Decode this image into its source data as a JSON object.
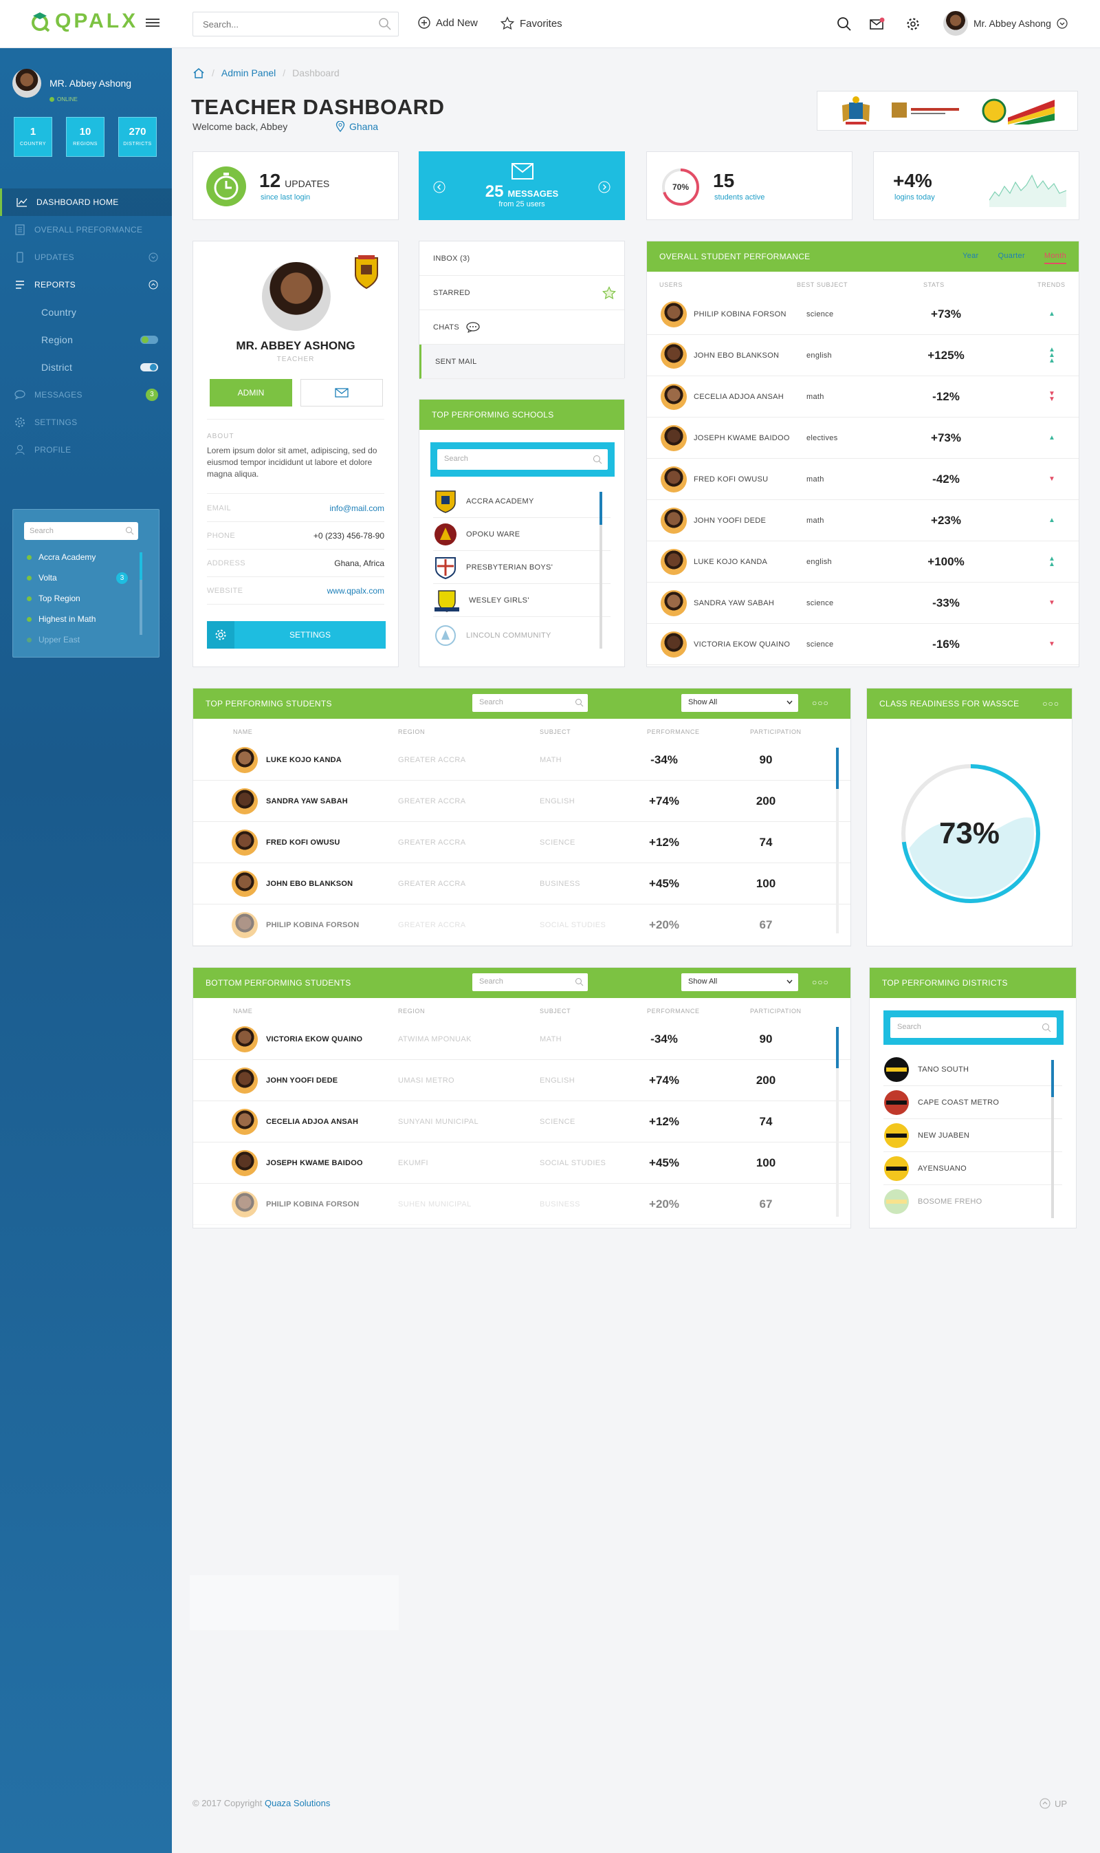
{
  "brand": {
    "logo": "QPALX",
    "accent": "#7cc242",
    "teal": "#1ebde0",
    "blue": "#1d7fb8",
    "sidebar_bg": "#1d6aa0"
  },
  "topbar": {
    "search_placeholder": "Search...",
    "add_new": "Add New",
    "favorites": "Favorites",
    "user": "Mr. Abbey Ashong"
  },
  "sidebar": {
    "user": "MR. Abbey Ashong",
    "status": "ONLINE",
    "stats": [
      {
        "value": "1",
        "label": "COUNTRY"
      },
      {
        "value": "10",
        "label": "REGIONS"
      },
      {
        "value": "270",
        "label": "DISTRICTS"
      }
    ],
    "nav": [
      {
        "label": "DASHBOARD HOME",
        "icon": "chart-icon"
      },
      {
        "label": "OVERALL PREFORMANCE",
        "icon": "document-icon"
      },
      {
        "label": "UPDATES",
        "icon": "phone-icon"
      },
      {
        "label": "REPORTS",
        "icon": "list-icon"
      },
      {
        "label": "Country"
      },
      {
        "label": "Region"
      },
      {
        "label": "District"
      },
      {
        "label": "MESSAGES",
        "icon": "chat-icon",
        "badge": "3"
      },
      {
        "label": "SETTINGS",
        "icon": "gear-icon"
      },
      {
        "label": "PROFILE",
        "icon": "user-icon"
      }
    ],
    "panel": {
      "search": "Search",
      "items": [
        {
          "label": "Accra Academy"
        },
        {
          "label": "Volta",
          "badge": "3"
        },
        {
          "label": "Top Region"
        },
        {
          "label": "Highest in Math"
        },
        {
          "label": "Upper East"
        }
      ]
    }
  },
  "breadcrumb": {
    "item1": "Admin Panel",
    "item2": "Dashboard"
  },
  "page": {
    "title": "TEACHER DASHBOARD",
    "welcome": "Welcome back, Abbey",
    "location": "Ghana"
  },
  "kpis": {
    "updates": {
      "value": "12",
      "label": "UPDATES",
      "sub": "since last login"
    },
    "messages": {
      "value": "25",
      "label": "MESSAGES",
      "sub": "from 25 users"
    },
    "active": {
      "percent": "70%",
      "progress": 0.7,
      "value": "15",
      "sub": "students active"
    },
    "logins": {
      "value": "+4%",
      "sub": "logins today"
    }
  },
  "profile": {
    "name": "MR. ABBEY ASHONG",
    "role": "TEACHER",
    "admin_btn": "ADMIN",
    "about_label": "ABOUT",
    "about": "Lorem ipsum dolor sit amet, adipiscing, sed do eiusmod tempor incididunt ut labore et dolore magna aliqua.",
    "fields": [
      {
        "label": "EMAIL",
        "value": "info@mail.com"
      },
      {
        "label": "PHONE",
        "value": "+0 (233) 456-78-90"
      },
      {
        "label": "ADDRESS",
        "value": "Ghana, Africa"
      },
      {
        "label": "WEBSITE",
        "value": "www.qpalx.com"
      }
    ],
    "settings_btn": "SETTINGS"
  },
  "mailbox": {
    "items": [
      {
        "label": "INBOX (3)"
      },
      {
        "label": "STARRED"
      },
      {
        "label": "CHATS"
      },
      {
        "label": "SENT MAIL"
      }
    ]
  },
  "top_schools": {
    "title": "TOP PERFORMING SCHOOLS",
    "search": "Search",
    "items": [
      {
        "name": "ACCRA ACADEMY"
      },
      {
        "name": "OPOKU WARE"
      },
      {
        "name": "PRESBYTERIAN BOYS'"
      },
      {
        "name": "WESLEY GIRLS'"
      },
      {
        "name": "LINCOLN COMMUNITY"
      }
    ]
  },
  "overall": {
    "title": "OVERALL STUDENT PERFORMANCE",
    "tabs": [
      "Year",
      "Quarter",
      "Month"
    ],
    "columns": [
      "USERS",
      "BEST SUBJECT",
      "STATS",
      "TRENDS"
    ],
    "rows": [
      {
        "name": "PHILIP KOBINA FORSON",
        "subject": "science",
        "stat": "+73%",
        "trend": "up1"
      },
      {
        "name": "JOHN EBO BLANKSON",
        "subject": "english",
        "stat": "+125%",
        "trend": "up3"
      },
      {
        "name": "CECELIA ADJOA ANSAH",
        "subject": "math",
        "stat": "-12%",
        "trend": "down2"
      },
      {
        "name": "JOSEPH KWAME BAIDOO",
        "subject": "electives",
        "stat": "+73%",
        "trend": "up1"
      },
      {
        "name": "FRED KOFI OWUSU",
        "subject": "math",
        "stat": "-42%",
        "trend": "down1"
      },
      {
        "name": "JOHN YOOFI DEDE",
        "subject": "math",
        "stat": "+23%",
        "trend": "up1"
      },
      {
        "name": "LUKE KOJO KANDA",
        "subject": "english",
        "stat": "+100%",
        "trend": "up2"
      },
      {
        "name": "SANDRA YAW SABAH",
        "subject": "science",
        "stat": "-33%",
        "trend": "down1"
      },
      {
        "name": "VICTORIA EKOW QUAINO",
        "subject": "science",
        "stat": "-16%",
        "trend": "down1"
      }
    ]
  },
  "top_students": {
    "title": "TOP PERFORMING STUDENTS",
    "search": "Search",
    "filter": "Show All",
    "columns": [
      "NAME",
      "REGION",
      "SUBJECT",
      "PERFORMANCE",
      "PARTICIPATION"
    ],
    "rows": [
      {
        "name": "LUKE KOJO KANDA",
        "region": "GREATER ACCRA",
        "subject": "MATH",
        "perf": "-34%",
        "part": "90"
      },
      {
        "name": "SANDRA YAW SABAH",
        "region": "GREATER ACCRA",
        "subject": "ENGLISH",
        "perf": "+74%",
        "part": "200"
      },
      {
        "name": "FRED KOFI OWUSU",
        "region": "GREATER ACCRA",
        "subject": "SCIENCE",
        "perf": "+12%",
        "part": "74"
      },
      {
        "name": "JOHN EBO BLANKSON",
        "region": "GREATER ACCRA",
        "subject": "BUSINESS",
        "perf": "+45%",
        "part": "100"
      },
      {
        "name": "PHILIP KOBINA FORSON",
        "region": "GREATER ACCRA",
        "subject": "SOCIAL STUDIES",
        "perf": "+20%",
        "part": "67"
      }
    ]
  },
  "readiness": {
    "title": "CLASS READINESS FOR WASSCE",
    "value": "73%",
    "progress": 0.73
  },
  "bottom_students": {
    "title": "BOTTOM PERFORMING STUDENTS",
    "search": "Search",
    "filter": "Show All",
    "columns": [
      "NAME",
      "REGION",
      "SUBJECT",
      "PERFORMANCE",
      "PARTICIPATION"
    ],
    "rows": [
      {
        "name": "VICTORIA EKOW QUAINO",
        "region": "ATWIMA MPONUAK",
        "subject": "MATH",
        "perf": "-34%",
        "part": "90"
      },
      {
        "name": "JOHN YOOFI DEDE",
        "region": "UMASI METRO",
        "subject": "ENGLISH",
        "perf": "+74%",
        "part": "200"
      },
      {
        "name": "CECELIA ADJOA ANSAH",
        "region": "SUNYANI MUNICIPAL",
        "subject": "SCIENCE",
        "perf": "+12%",
        "part": "74"
      },
      {
        "name": "JOSEPH KWAME BAIDOO",
        "region": "EKUMFI",
        "subject": "SOCIAL STUDIES",
        "perf": "+45%",
        "part": "100"
      },
      {
        "name": "PHILIP KOBINA FORSON",
        "region": "SUHEN MUNICIPAL",
        "subject": "BUSINESS",
        "perf": "+20%",
        "part": "67"
      }
    ]
  },
  "districts": {
    "title": "TOP PERFORMING DISTRICTS",
    "search": "Search",
    "items": [
      {
        "name": "TANO SOUTH"
      },
      {
        "name": "CAPE COAST METRO"
      },
      {
        "name": "NEW JUABEN"
      },
      {
        "name": "AYENSUANO"
      },
      {
        "name": "BOSOME FREHO"
      }
    ]
  },
  "footer": {
    "copyright": "© 2017 Copyright",
    "company": "Quaza Solutions",
    "up": "UP"
  }
}
